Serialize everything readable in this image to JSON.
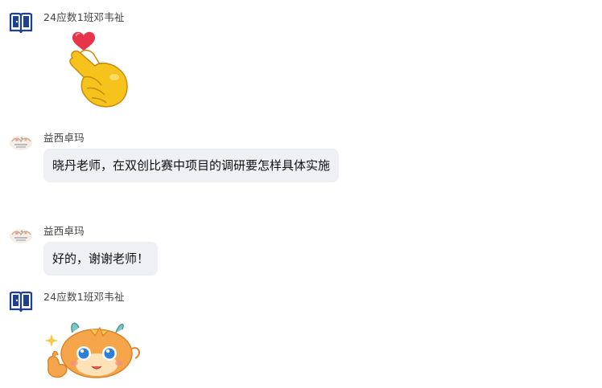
{
  "messages": [
    {
      "sender": "24应数1班邓韦祉",
      "avatar_icon": "book-icon",
      "type": "sticker",
      "sticker": "heart-finger-sticker"
    },
    {
      "sender": "益西卓玛",
      "avatar_icon": "flower-illustration-avatar",
      "type": "text",
      "text": "晓丹老师，在双创比赛中项目的调研要怎样具体实施"
    },
    {
      "sender": "益西卓玛",
      "avatar_icon": "flower-illustration-avatar",
      "type": "text",
      "text": "好的，谢谢老师！"
    },
    {
      "sender": "24应数1班邓韦祉",
      "avatar_icon": "book-icon",
      "type": "sticker",
      "sticker": "dragon-thumbs-up-sticker"
    }
  ],
  "colors": {
    "bubble_bg": "#eff0f3",
    "avatar_blue": "#1f3f8f",
    "heart_red": "#e8344a",
    "hand_yellow": "#f6c21c"
  }
}
